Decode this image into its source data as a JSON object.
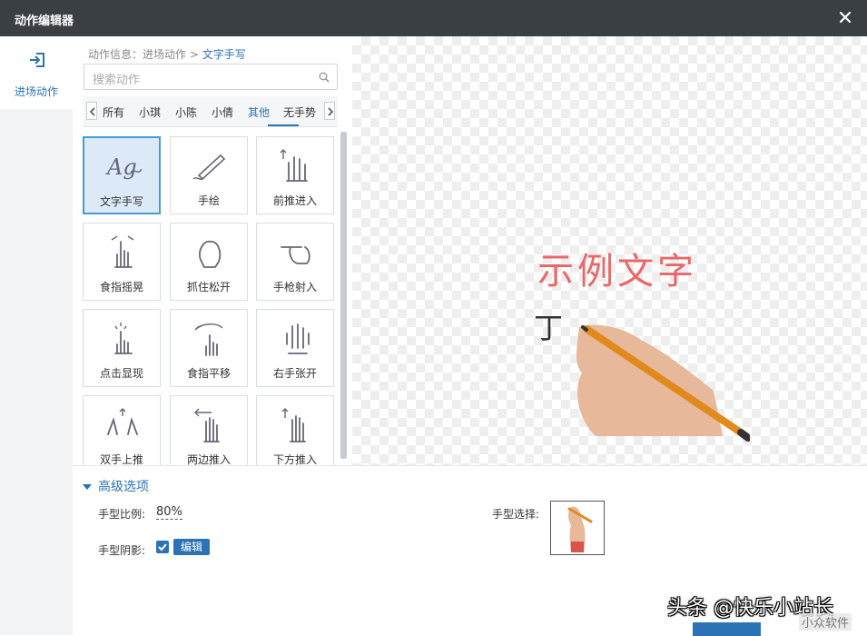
{
  "window": {
    "title": "动作编辑器"
  },
  "leftnav": {
    "item_label": "进场动作"
  },
  "breadcrumb": {
    "prefix": "动作信息：",
    "section": "进场动作",
    "separator": ">",
    "current": "文字手写"
  },
  "search": {
    "placeholder": "搜索动作"
  },
  "tabs": [
    "所有",
    "小琪",
    "小陈",
    "小倩",
    "其他",
    "无手势"
  ],
  "active_tab": "其他",
  "actions": [
    {
      "label": "文字手写",
      "icon": "handwriting-icon",
      "selected": true
    },
    {
      "label": "手绘",
      "icon": "pencil-icon"
    },
    {
      "label": "前推进入",
      "icon": "hand-push-up-icon"
    },
    {
      "label": "食指摇晃",
      "icon": "finger-wave-icon"
    },
    {
      "label": "抓住松开",
      "icon": "grab-hand-icon"
    },
    {
      "label": "手枪射入",
      "icon": "hand-point-icon"
    },
    {
      "label": "点击显现",
      "icon": "tap-icon"
    },
    {
      "label": "食指平移",
      "icon": "finger-swipe-icon"
    },
    {
      "label": "右手张开",
      "icon": "open-hand-icon"
    },
    {
      "label": "双手上推",
      "icon": "two-hands-up-icon"
    },
    {
      "label": "两边推入",
      "icon": "hand-push-left-icon"
    },
    {
      "label": "下方推入",
      "icon": "hand-push-bottom-icon"
    }
  ],
  "preview": {
    "sample_text": "示例文字"
  },
  "advanced": {
    "title": "高级选项",
    "hand_ratio_label": "手型比例:",
    "hand_ratio_value": "80%",
    "hand_shadow_label": "手型阴影:",
    "hand_shadow_checked": true,
    "edit_label": "编辑",
    "hand_select_label": "手型选择:"
  },
  "watermark": {
    "line1": "头条 @快乐小站长",
    "line2": "小众软件"
  },
  "colors": {
    "accent": "#2b73b5",
    "titlebar": "#3a3f44",
    "sample_text": "#e8686a"
  }
}
